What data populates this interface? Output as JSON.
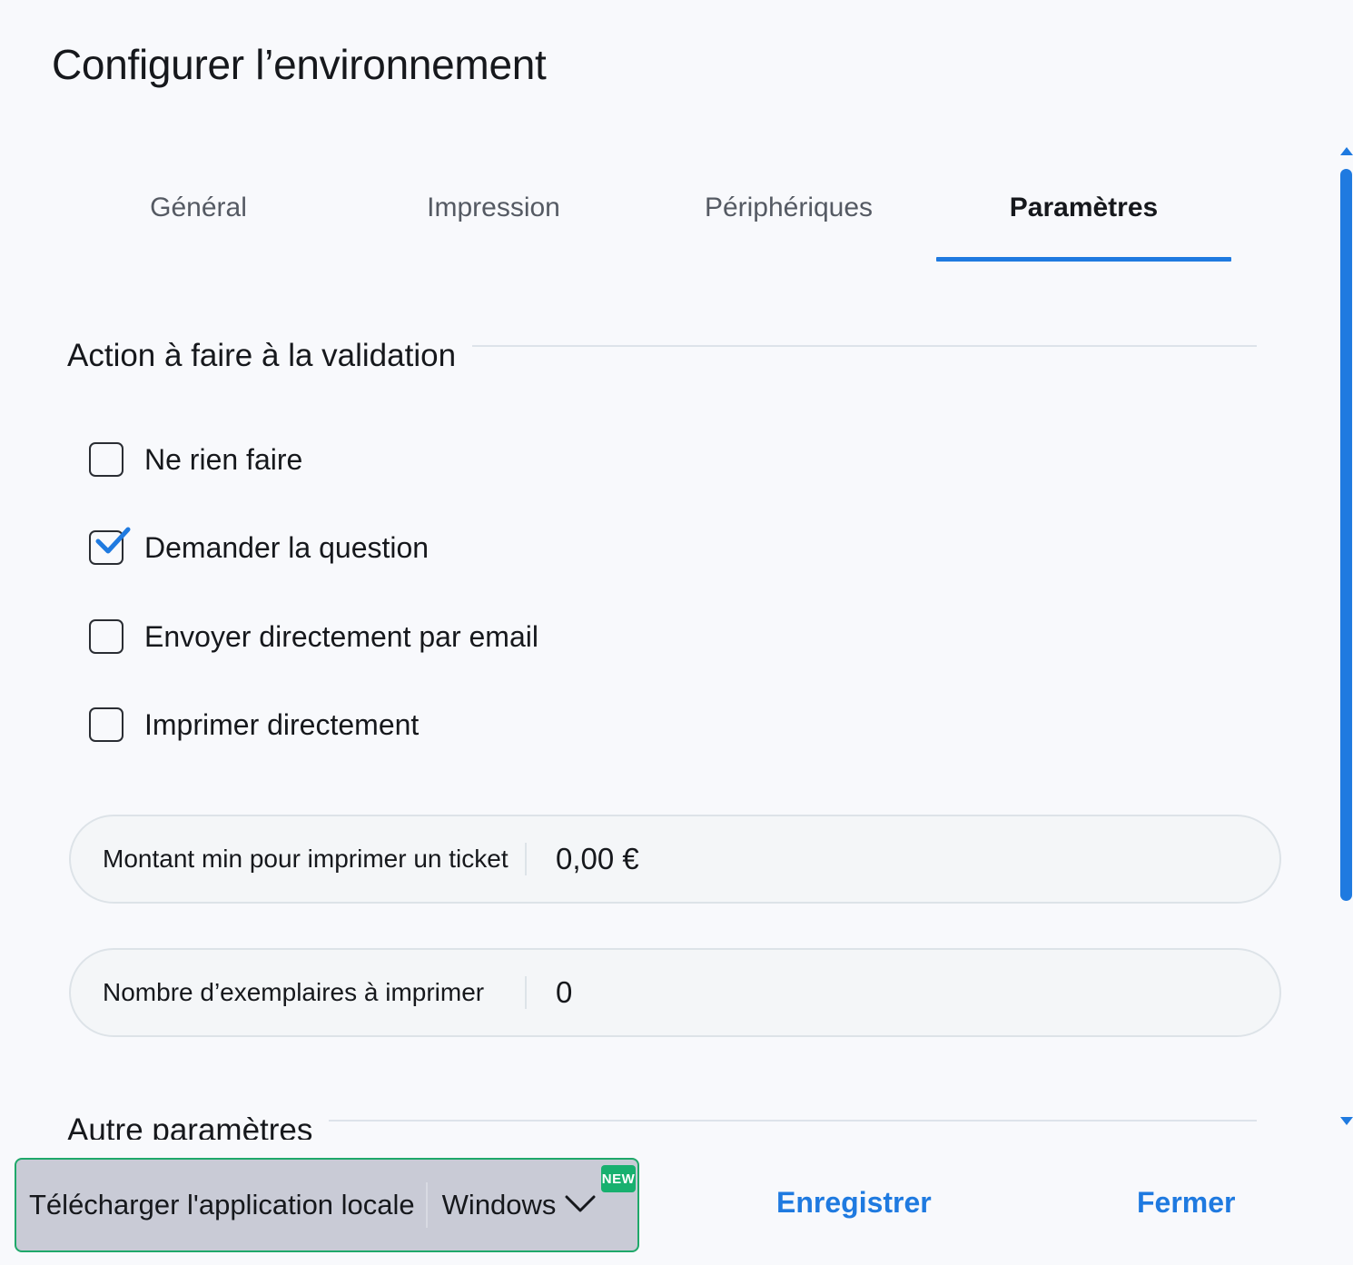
{
  "title": "Configurer l’environnement",
  "tabs": [
    {
      "label": "Général",
      "active": false
    },
    {
      "label": "Impression",
      "active": false
    },
    {
      "label": "Périphériques",
      "active": false
    },
    {
      "label": "Paramètres",
      "active": true
    }
  ],
  "section_validation": {
    "title": "Action à faire à la validation",
    "options": [
      {
        "label": "Ne rien faire",
        "checked": false
      },
      {
        "label": "Demander la question",
        "checked": true
      },
      {
        "label": "Envoyer directement par email",
        "checked": false
      },
      {
        "label": "Imprimer directement",
        "checked": false
      }
    ]
  },
  "fields": {
    "min_amount": {
      "label": "Montant min pour imprimer un ticket",
      "value": "0,00 €"
    },
    "copies": {
      "label": "Nombre d’exemplaires à imprimer",
      "value": "0"
    }
  },
  "section_other": {
    "title": "Autre paramètres"
  },
  "footer": {
    "download_label": "Télécharger l'application locale",
    "os_selected": "Windows",
    "badge": "NEW",
    "save_label": "Enregistrer",
    "close_label": "Fermer"
  },
  "colors": {
    "accent": "#1f7ae0",
    "badge": "#18b06f",
    "download_bg": "#c9cbd6"
  },
  "icons": {
    "checkbox_checked": "checkmark-icon",
    "dropdown": "chevron-down-icon",
    "scroll_up": "arrow-up-icon",
    "scroll_down": "arrow-down-icon"
  }
}
